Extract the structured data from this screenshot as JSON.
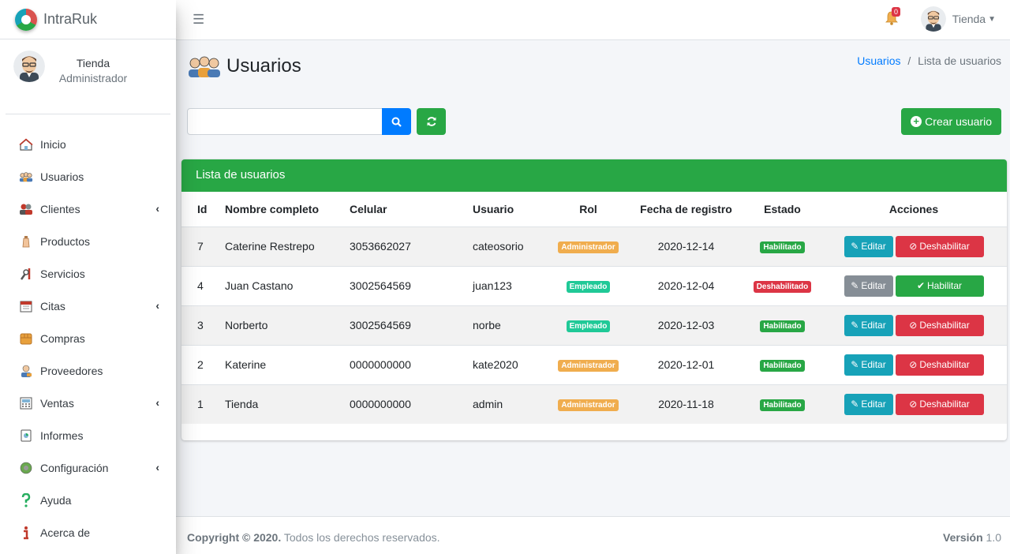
{
  "brand": {
    "name": "IntraRuk"
  },
  "user_panel": {
    "name": "Tienda",
    "role": "Administrador"
  },
  "sidebar": {
    "items": [
      {
        "label": "Inicio",
        "icon": "home-icon",
        "has_arrow": false
      },
      {
        "label": "Usuarios",
        "icon": "users-icon",
        "has_arrow": false
      },
      {
        "label": "Clientes",
        "icon": "clients-icon",
        "has_arrow": true
      },
      {
        "label": "Productos",
        "icon": "product-icon",
        "has_arrow": false
      },
      {
        "label": "Servicios",
        "icon": "tools-icon",
        "has_arrow": false
      },
      {
        "label": "Citas",
        "icon": "calendar-icon",
        "has_arrow": true
      },
      {
        "label": "Compras",
        "icon": "box-icon",
        "has_arrow": false
      },
      {
        "label": "Proveedores",
        "icon": "supplier-icon",
        "has_arrow": false
      },
      {
        "label": "Ventas",
        "icon": "register-icon",
        "has_arrow": true
      },
      {
        "label": "Informes",
        "icon": "report-icon",
        "has_arrow": false
      },
      {
        "label": "Configuración",
        "icon": "settings-icon",
        "has_arrow": true
      },
      {
        "label": "Ayuda",
        "icon": "help-icon",
        "has_arrow": false
      },
      {
        "label": "Acerca de",
        "icon": "info-icon",
        "has_arrow": false
      }
    ],
    "arrow": "‹"
  },
  "navbar": {
    "notification_count": "0",
    "user_name": "Tienda"
  },
  "page": {
    "title": "Usuarios"
  },
  "breadcrumb": {
    "link": "Usuarios",
    "separator": "/",
    "current": "Lista de usuarios"
  },
  "toolbar": {
    "search_value": "",
    "create_label": "Crear usuario"
  },
  "card": {
    "title": "Lista de usuarios"
  },
  "table": {
    "headers": [
      "Id",
      "Nombre completo",
      "Celular",
      "Usuario",
      "Rol",
      "Fecha de registro",
      "Estado",
      "Acciones"
    ],
    "rows": [
      {
        "id": "7",
        "name": "Caterine Restrepo",
        "cel": "3053662027",
        "user": "cateosorio",
        "rol": "Administrador",
        "rol_type": "admin",
        "fecha": "2020-12-14",
        "estado": "Habilitado",
        "estado_type": "on",
        "edit": "Editar",
        "toggle": "Deshabilitar"
      },
      {
        "id": "4",
        "name": "Juan Castano",
        "cel": "3002564569",
        "user": "juan123",
        "rol": "Empleado",
        "rol_type": "emp",
        "fecha": "2020-12-04",
        "estado": "Deshabilitado",
        "estado_type": "off",
        "edit": "Editar",
        "toggle": "Habilitar"
      },
      {
        "id": "3",
        "name": "Norberto",
        "cel": "3002564569",
        "user": "norbe",
        "rol": "Empleado",
        "rol_type": "emp",
        "fecha": "2020-12-03",
        "estado": "Habilitado",
        "estado_type": "on",
        "edit": "Editar",
        "toggle": "Deshabilitar"
      },
      {
        "id": "2",
        "name": "Katerine",
        "cel": "0000000000",
        "user": "kate2020",
        "rol": "Administrador",
        "rol_type": "admin",
        "fecha": "2020-12-01",
        "estado": "Habilitado",
        "estado_type": "on",
        "edit": "Editar",
        "toggle": "Deshabilitar"
      },
      {
        "id": "1",
        "name": "Tienda",
        "cel": "0000000000",
        "user": "admin",
        "rol": "Administrador",
        "rol_type": "admin",
        "fecha": "2020-11-18",
        "estado": "Habilitado",
        "estado_type": "on",
        "edit": "Editar",
        "toggle": "Deshabilitar"
      }
    ]
  },
  "footer": {
    "copyright_bold": "Copyright © 2020.",
    "copyright_rest": "Todos los derechos reservados.",
    "version_label": "Versión",
    "version_value": "1.0"
  },
  "colors": {
    "primary": "#007bff",
    "success": "#28a745",
    "danger": "#dc3545",
    "info": "#17a2b8",
    "warning": "#f0ad4e"
  }
}
